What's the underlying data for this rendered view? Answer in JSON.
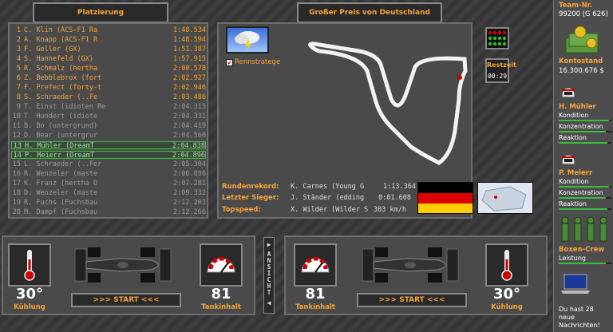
{
  "standings": {
    "title": "Platzierung",
    "rows": [
      {
        "pos": "1",
        "name": "C. Klin (ACS-F1 Ra",
        "time": "1:48.534",
        "style": "top"
      },
      {
        "pos": "2",
        "name": "A. Knapp (ACS-F1 R",
        "time": "1:48.594",
        "style": "top"
      },
      {
        "pos": "3",
        "name": "F. Geller (GX)",
        "time": "1:51.387",
        "style": "top"
      },
      {
        "pos": "4",
        "name": "S. Hannefeld (GX)",
        "time": "1:57.915",
        "style": "top"
      },
      {
        "pos": "5",
        "name": "R. Schmalz (hertha",
        "time": "2:00.578",
        "style": "top"
      },
      {
        "pos": "6",
        "name": "Z. Bebblebrox (fort",
        "time": "2:02.927",
        "style": "top"
      },
      {
        "pos": "7",
        "name": "F. Prefect (forty-t",
        "time": "2:02.946",
        "style": "top"
      },
      {
        "pos": "8",
        "name": "S. Schraeder (..Fe",
        "time": "2:03.486",
        "style": "top"
      },
      {
        "pos": "9",
        "name": "T. Einst (idioten Re",
        "time": "2:04.315",
        "style": "dim"
      },
      {
        "pos": "10",
        "name": "T. Hundert (idiote",
        "time": "2:04.331",
        "style": "dim"
      },
      {
        "pos": "11",
        "name": "B. Bo (untergrund)",
        "time": "2:04.419",
        "style": "dim"
      },
      {
        "pos": "12",
        "name": "D. Bear (untergrur",
        "time": "2:04.560",
        "style": "dim"
      },
      {
        "pos": "13",
        "name": "H. Mühler (DreamT",
        "time": "2:04.838",
        "style": "hl"
      },
      {
        "pos": "14",
        "name": "P. Meierr (DreamT",
        "time": "2:04.896",
        "style": "hl"
      },
      {
        "pos": "15",
        "name": "L. Schraeder (..Fer",
        "time": "2:05.304",
        "style": "dim"
      },
      {
        "pos": "16",
        "name": "R. Wenzeler (maste",
        "time": "2:06.896",
        "style": "dim"
      },
      {
        "pos": "17",
        "name": "K. Franz (hertha O",
        "time": "2:07.281",
        "style": "dim"
      },
      {
        "pos": "18",
        "name": "D. Wenzeler (maste",
        "time": "2:09.332",
        "style": "dim"
      },
      {
        "pos": "19",
        "name": "R. Fuchs (Fuchsbau",
        "time": "2:12.203",
        "style": "dim"
      },
      {
        "pos": "20",
        "name": "M. Dampf (Fuchsbau",
        "time": "2:12.266",
        "style": "dim"
      }
    ]
  },
  "race": {
    "title": "Großer Preis von Deutschland",
    "checkbox_checked": "✔",
    "checkbox_label": "Rennstratege",
    "restzeit_label": "Restzeit",
    "restzeit_value": "00:29",
    "rekord_label": "Rundenrekord:",
    "rekord_name": "K. Carnes (Young G",
    "rekord_time": "1:13.364",
    "sieger_label": "Letzter Sieger:",
    "sieger_name": "J. Ständer (edding",
    "sieger_time": "0:01.608",
    "speed_label": "Topspeed:",
    "speed_name": "X. Wilder (Wilder S",
    "speed_value": "303 km/h"
  },
  "left_car": {
    "temp": "30°",
    "temp_label": "Kühlung",
    "fuel": "81",
    "fuel_label": "Tankinhalt",
    "start": ">>>  START  <<<"
  },
  "right_car": {
    "temp": "30°",
    "temp_label": "Kühlung",
    "fuel": "81",
    "fuel_label": "Tankinhalt",
    "start": ">>>  START  <<<"
  },
  "ansicht": "ANSICHT",
  "sidebar": {
    "team_label": "Team-Nr.",
    "team_value": "99200 (G 626)",
    "konto_label": "Kontostand",
    "konto_value": "16.300.676 $",
    "driver1": {
      "name": "H. Mühler",
      "kondition": "Kondition",
      "konzentration": "Konzentration",
      "reaktion": "Reaktion",
      "kondition_level": 0.95,
      "konzentration_level": 0.9,
      "reaktion_level": 0.92
    },
    "driver2": {
      "name": "P. Meierr",
      "kondition": "Kondition",
      "konzentration": "Konzentration",
      "reaktion": "Reaktion",
      "kondition_level": 0.95,
      "konzentration_level": 0.9,
      "reaktion_level": 0.92
    },
    "crew_label": "Boxen-Crew",
    "crew_leistung": "Leistung",
    "crew_level": 0.9,
    "message": "Du hast 28 neue Nachrichten!"
  },
  "colors": {
    "accent": "#f4a43a",
    "highlight": "#3dbb3d"
  }
}
